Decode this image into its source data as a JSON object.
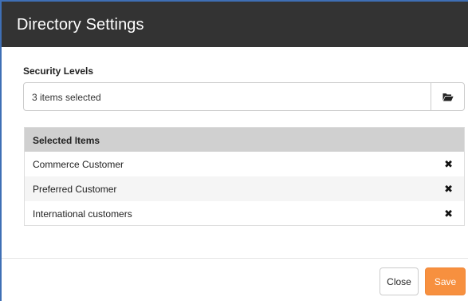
{
  "dialog": {
    "title": "Directory Settings"
  },
  "security_levels": {
    "label": "Security Levels",
    "value": "3 items selected",
    "browse_icon": "folder-open-icon"
  },
  "selected_items": {
    "header": "Selected Items",
    "rows": [
      {
        "label": "Commerce Customer",
        "remove_icon": "close-icon"
      },
      {
        "label": "Preferred Customer",
        "remove_icon": "close-icon"
      },
      {
        "label": "International customers",
        "remove_icon": "close-icon"
      }
    ]
  },
  "footer": {
    "close_label": "Close",
    "save_label": "Save"
  },
  "colors": {
    "header_bg": "#333333",
    "accent_border": "#3f6fb5",
    "save_button": "#f7903f",
    "table_header_bg": "#d0d0d0"
  }
}
